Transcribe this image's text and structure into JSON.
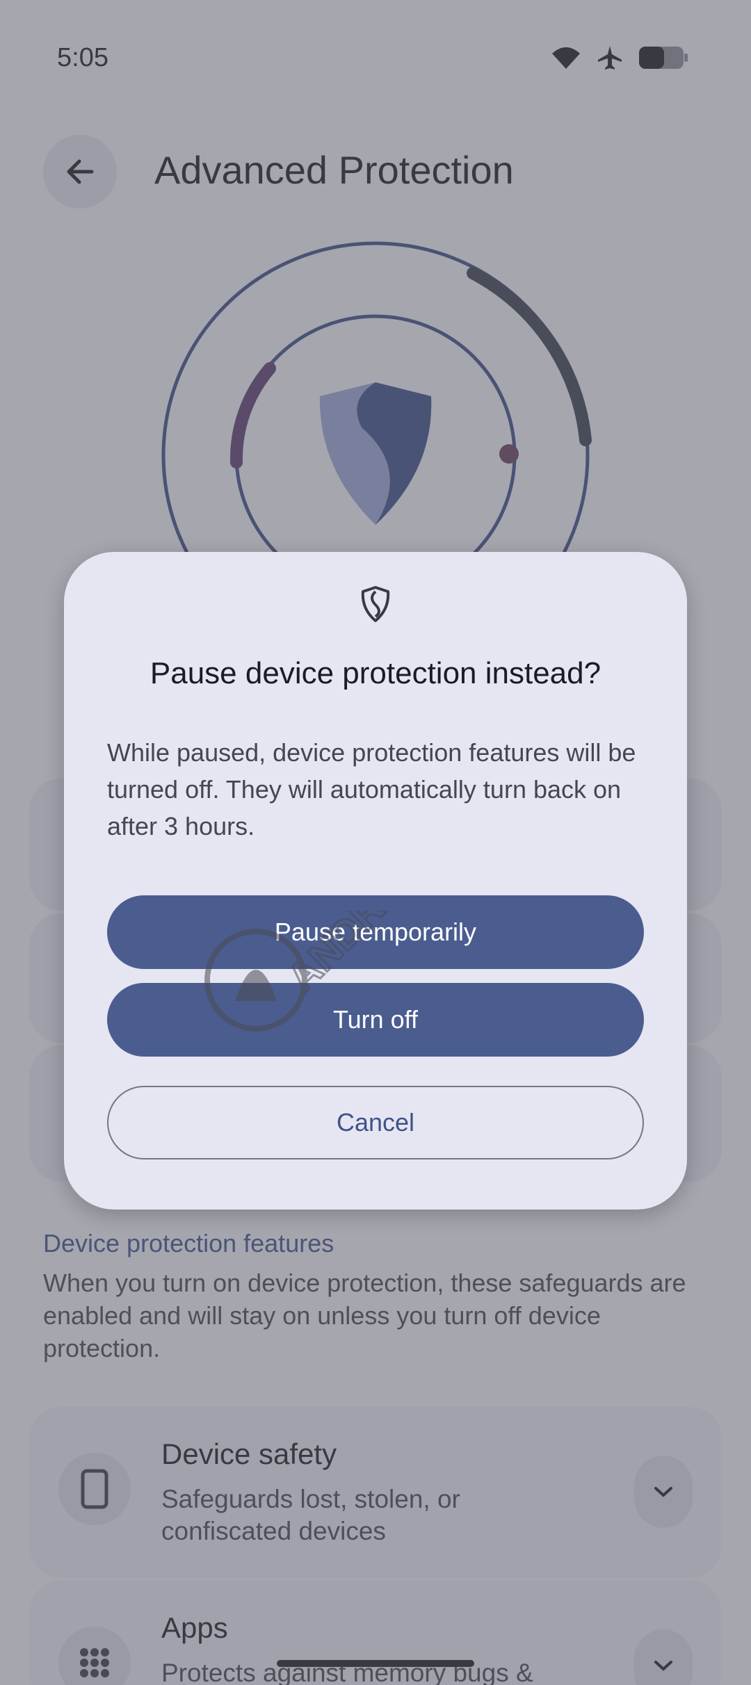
{
  "status_bar": {
    "time": "5:05"
  },
  "app_bar": {
    "title": "Advanced Protection"
  },
  "dialog": {
    "title": "Pause device protection instead?",
    "body": "While paused, device protection features will be turned off. They will automatically turn back on after 3 hours.",
    "pause_button": "Pause temporarily",
    "turn_off_button": "Turn off",
    "cancel_button": "Cancel"
  },
  "section": {
    "heading": "Device protection features",
    "description": "When you turn on device protection, these safeguards are enabled and will stay on unless you turn off device protection."
  },
  "features": [
    {
      "title": "Device safety",
      "subtitle": "Safeguards lost, stolen, or confiscated devices",
      "icon": "phone-icon"
    },
    {
      "title": "Apps",
      "subtitle": "Protects against memory bugs &",
      "icon": "grid-icon"
    }
  ],
  "watermark": {
    "text": "ANDROID AUTHORITY"
  },
  "colors": {
    "primary": "#4b5d8f",
    "dialog_surface": "#e6e6f2",
    "accent_text": "#3f5289"
  }
}
